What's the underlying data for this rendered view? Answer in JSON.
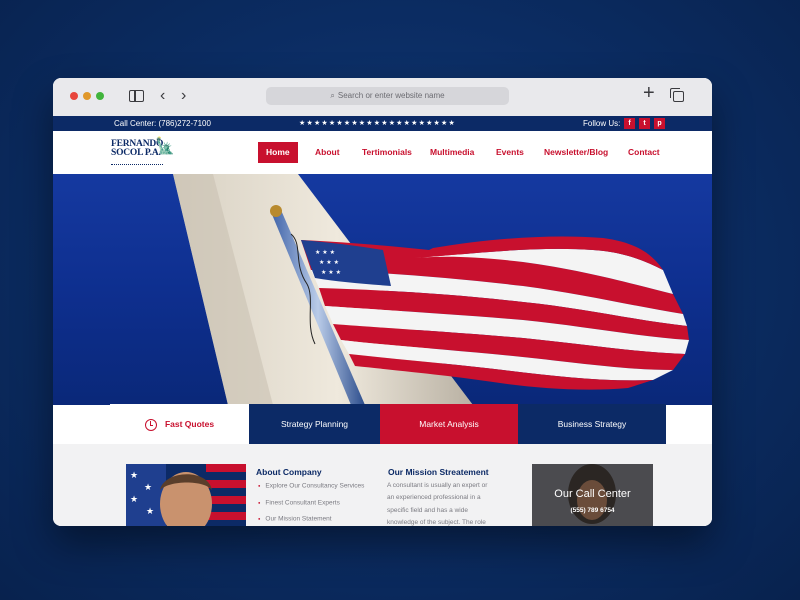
{
  "browser": {
    "url_placeholder": "Search or enter website name",
    "icons": [
      "sidebar-icon",
      "back-icon",
      "forward-icon",
      "search-icon",
      "new-tab-icon",
      "tabs-overview-icon"
    ]
  },
  "topbar": {
    "call_center": "Call Center: (786)272-7100",
    "stars": "★★★★★★★★★★★★★★★★★★★★★",
    "follow_us": "Follow Us:",
    "social": [
      "f",
      "t",
      "p"
    ]
  },
  "logo": {
    "line1": "FERNANDO",
    "line2": "SOCOL P.A."
  },
  "nav": {
    "items": [
      "Home",
      "About",
      "Tertimonials",
      "Multimedia",
      "Events",
      "Newsletter/Blog",
      "Contact"
    ],
    "active": "Home"
  },
  "tabs": [
    "Fast Quotes",
    "Strategy Planning",
    "Market Analysis",
    "Business Strategy"
  ],
  "about": {
    "title": "About Company",
    "items": [
      "Explore Our Consultancy Services",
      "Finest Consultant Experts",
      "Our Mission Statement"
    ]
  },
  "mission": {
    "title": "Our Mission Streatement",
    "lines": [
      "A consultant is usually an expert or",
      "an experienced professional in a",
      "specific field and has a wide",
      "knowledge of the subject. The role"
    ]
  },
  "callbox": {
    "title": "Our Call Center",
    "phone": "(555) 789 6754"
  },
  "colors": {
    "navy": "#0c2a66",
    "red": "#c8102e",
    "page_bg": "#0b2c62"
  }
}
